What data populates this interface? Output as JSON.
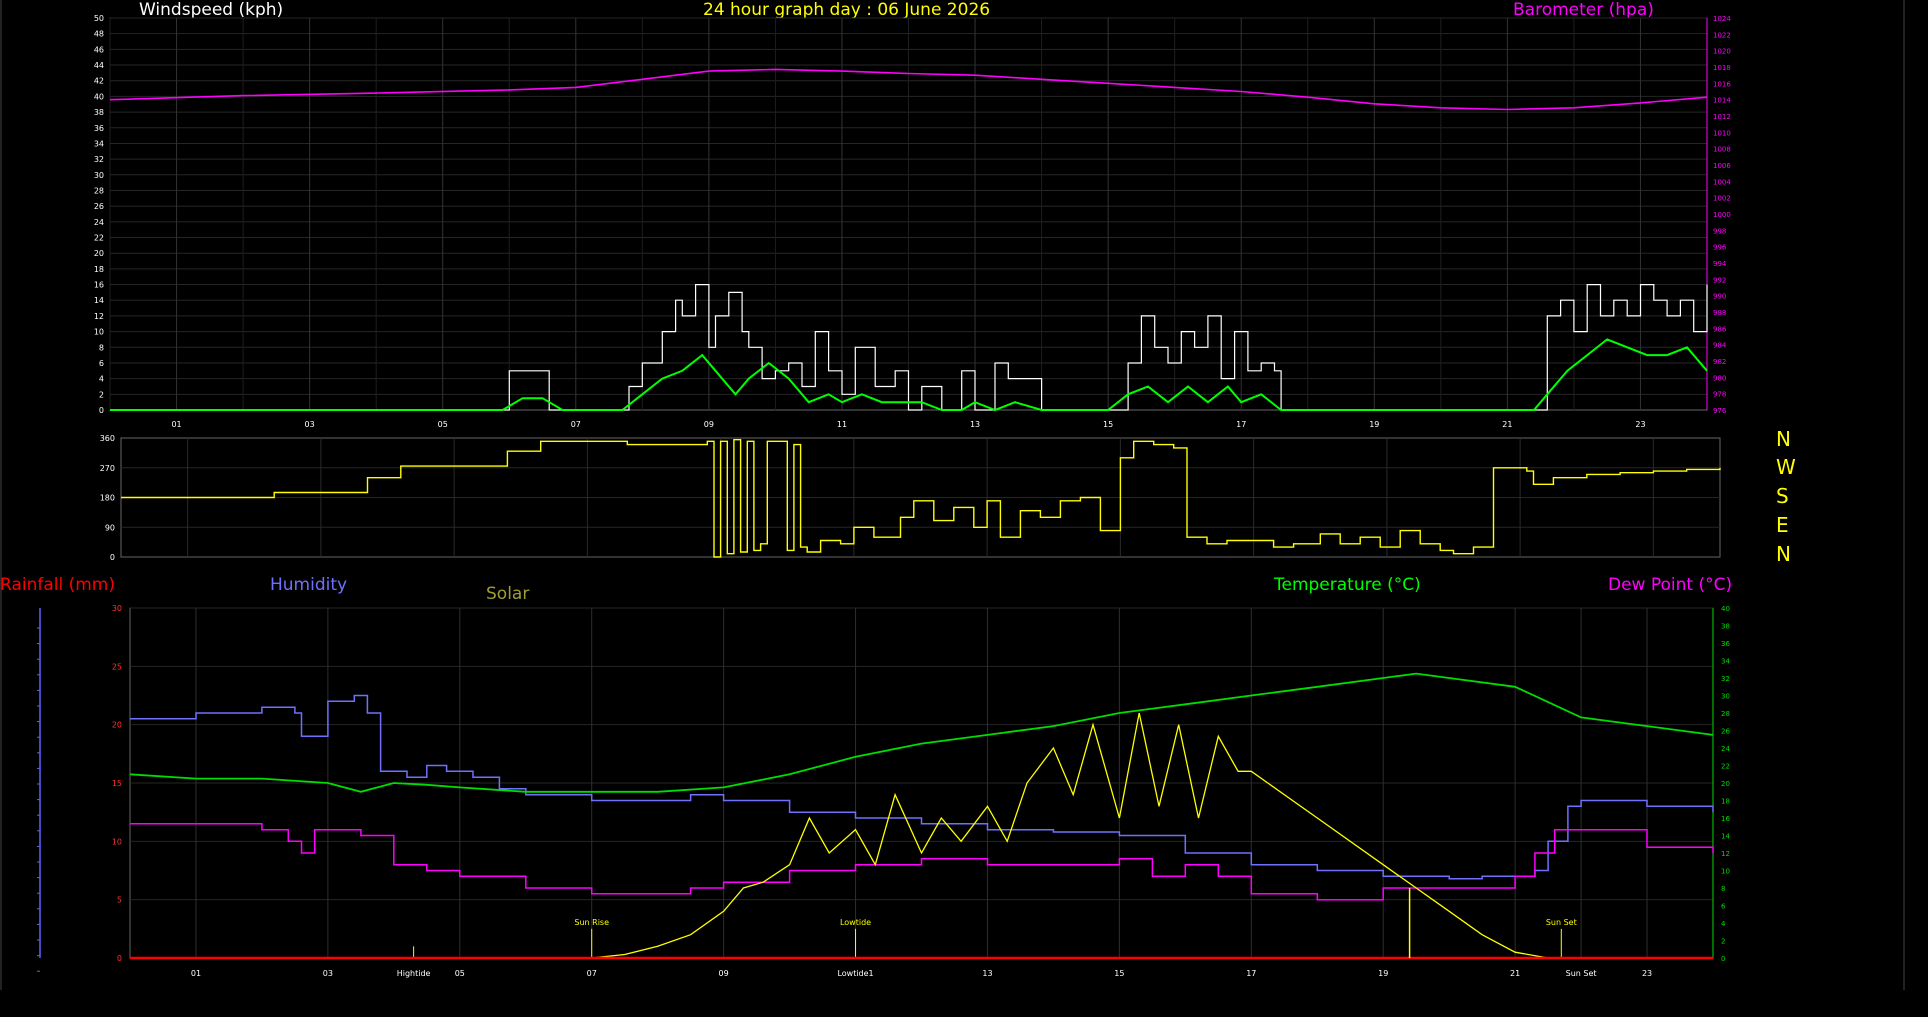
{
  "header": {
    "windspeed_title": "Windspeed (kph)",
    "main_title": "24 hour graph day : 06 June 2026",
    "barometer_title": "Barometer (hpa)"
  },
  "compass": [
    "N",
    "W",
    "S",
    "E",
    "N"
  ],
  "bottom_labels": {
    "rainfall": "Rainfall (mm)",
    "humidity": "Humidity",
    "solar": "Solar",
    "temperature": "Temperature (°C)",
    "dewpoint": "Dew Point (°C)"
  },
  "colors": {
    "background": "#000000",
    "windspeed": "#ffffff",
    "wind_avg": "#00ff00",
    "barometer": "#ff00ff",
    "direction": "#ffff00",
    "humidity": "#7070ff",
    "solar": "#ffff00",
    "temperature": "#00dd00",
    "dewpoint": "#ff00ff",
    "rainfall": "#ff0000"
  },
  "chart_data": [
    {
      "type": "line",
      "name": "wind-barometer",
      "title": "Windspeed (kph)",
      "y2label": "Barometer (hpa)",
      "xlim": [
        0,
        24
      ],
      "ylim": [
        0,
        50
      ],
      "y2lim": [
        976,
        1024
      ],
      "x_ticks": [
        "01",
        "03",
        "05",
        "07",
        "09",
        "11",
        "13",
        "15",
        "17",
        "19",
        "21",
        "23"
      ],
      "y_ticks": [
        0,
        2,
        4,
        6,
        8,
        10,
        12,
        14,
        16,
        18,
        20,
        22,
        24,
        26,
        28,
        30,
        32,
        34,
        36,
        38,
        40,
        42,
        44,
        46,
        48,
        50
      ],
      "y2_ticks": [
        976,
        978,
        980,
        982,
        984,
        986,
        988,
        990,
        992,
        994,
        996,
        998,
        1000,
        1002,
        1004,
        1006,
        1008,
        1010,
        1012,
        1014,
        1016,
        1018,
        1020,
        1022,
        1024
      ],
      "series": [
        {
          "key": "gust",
          "x": [
            0,
            5.9,
            6.0,
            6.5,
            6.6,
            7.7,
            7.8,
            8.0,
            8.3,
            8.5,
            8.6,
            8.8,
            9.0,
            9.1,
            9.3,
            9.5,
            9.6,
            9.8,
            10.0,
            10.2,
            10.4,
            10.6,
            10.8,
            11.0,
            11.2,
            11.5,
            11.8,
            12.0,
            12.2,
            12.5,
            12.8,
            13.0,
            13.3,
            13.5,
            14.0,
            15.1,
            15.3,
            15.5,
            15.7,
            15.9,
            16.1,
            16.3,
            16.5,
            16.7,
            16.9,
            17.1,
            17.3,
            17.5,
            17.6,
            21.5,
            21.6,
            21.8,
            22.0,
            22.2,
            22.4,
            22.6,
            22.8,
            23.0,
            23.2,
            23.4,
            23.6,
            23.8,
            24.0
          ],
          "y": [
            0,
            0,
            5,
            5,
            0,
            0,
            3,
            6,
            10,
            14,
            12,
            16,
            8,
            12,
            15,
            10,
            8,
            4,
            5,
            6,
            3,
            10,
            5,
            2,
            8,
            3,
            5,
            0,
            3,
            0,
            5,
            0,
            6,
            4,
            0,
            0,
            6,
            12,
            8,
            6,
            10,
            8,
            12,
            4,
            10,
            5,
            6,
            5,
            0,
            0,
            12,
            14,
            10,
            16,
            12,
            14,
            12,
            16,
            14,
            12,
            14,
            10,
            16
          ]
        },
        {
          "key": "avg",
          "x": [
            0,
            5.9,
            6.2,
            6.5,
            6.8,
            7.7,
            8.0,
            8.3,
            8.6,
            8.9,
            9.1,
            9.4,
            9.6,
            9.9,
            10.2,
            10.5,
            10.8,
            11.0,
            11.3,
            11.6,
            11.9,
            12.2,
            12.5,
            12.8,
            13.0,
            13.3,
            13.6,
            14.0,
            15.0,
            15.3,
            15.6,
            15.9,
            16.2,
            16.5,
            16.8,
            17.0,
            17.3,
            17.6,
            21.4,
            21.6,
            21.9,
            22.2,
            22.5,
            22.8,
            23.1,
            23.4,
            23.7,
            24.0
          ],
          "y": [
            0,
            0,
            1.5,
            1.5,
            0,
            0,
            2,
            4,
            5,
            7,
            5,
            2,
            4,
            6,
            4,
            1,
            2,
            1,
            2,
            1,
            1,
            1,
            0,
            0,
            1,
            0,
            1,
            0,
            0,
            2,
            3,
            1,
            3,
            1,
            3,
            1,
            2,
            0,
            0,
            2,
            5,
            7,
            9,
            8,
            7,
            7,
            8,
            5
          ]
        },
        {
          "key": "baro",
          "x": [
            0,
            2,
            4,
            6,
            7,
            8,
            9,
            10,
            11,
            12,
            13,
            14,
            15,
            16,
            17,
            18,
            19,
            20,
            21,
            22,
            23,
            24
          ],
          "y": [
            1014,
            1014.5,
            1014.8,
            1015.2,
            1015.5,
            1016.5,
            1017.5,
            1017.7,
            1017.5,
            1017.2,
            1017.0,
            1016.5,
            1016.0,
            1015.5,
            1015.0,
            1014.3,
            1013.5,
            1013.0,
            1012.8,
            1013.0,
            1013.6,
            1014.3
          ]
        }
      ]
    },
    {
      "type": "line",
      "name": "wind-direction",
      "xlim": [
        0,
        24
      ],
      "ylim": [
        0,
        360
      ],
      "y_ticks": [
        0,
        90,
        180,
        270,
        360
      ],
      "series": [
        {
          "key": "dir",
          "x": [
            0,
            2.2,
            2.3,
            3.6,
            3.7,
            4.1,
            4.2,
            5.7,
            5.8,
            6.2,
            6.3,
            7.5,
            7.6,
            8.8,
            8.9,
            9.0,
            9.1,
            9.2,
            9.3,
            9.4,
            9.5,
            9.6,
            9.7,
            10.0,
            10.1,
            10.2,
            10.3,
            10.5,
            10.8,
            11.0,
            11.3,
            11.7,
            11.9,
            12.2,
            12.5,
            12.8,
            13.0,
            13.2,
            13.5,
            13.8,
            14.1,
            14.4,
            14.7,
            15.0,
            15.2,
            15.5,
            15.8,
            16.0,
            16.3,
            16.6,
            17.0,
            17.3,
            17.6,
            18.0,
            18.3,
            18.6,
            18.9,
            19.2,
            19.5,
            19.8,
            20.0,
            20.3,
            20.6,
            21.0,
            21.1,
            21.2,
            21.5,
            22.0,
            22.5,
            23.0,
            23.5,
            24.0
          ],
          "y": [
            180,
            180,
            195,
            195,
            240,
            240,
            275,
            275,
            320,
            320,
            350,
            350,
            340,
            350,
            0,
            350,
            10,
            355,
            15,
            350,
            20,
            40,
            350,
            20,
            340,
            30,
            15,
            50,
            40,
            90,
            60,
            120,
            170,
            110,
            150,
            90,
            170,
            60,
            140,
            120,
            170,
            180,
            80,
            300,
            350,
            340,
            330,
            60,
            40,
            50,
            50,
            30,
            40,
            70,
            40,
            60,
            30,
            80,
            40,
            20,
            10,
            30,
            270,
            270,
            260,
            220,
            240,
            250,
            255,
            260,
            265,
            270
          ]
        }
      ]
    },
    {
      "type": "line",
      "name": "temp-humidity-solar-rain",
      "xlim": [
        0,
        24
      ],
      "ylim": [
        0,
        30
      ],
      "y2lim": [
        0,
        40
      ],
      "x_ticks": [
        "01",
        "03",
        "Hightide",
        "05",
        "07",
        "09",
        "Lowtide1",
        "13",
        "15",
        "17",
        "19",
        "21",
        "Sun Set",
        "23"
      ],
      "y_ticks": [
        0,
        5,
        10,
        15,
        20,
        25,
        30
      ],
      "y2_ticks": [
        0,
        2,
        4,
        6,
        8,
        10,
        12,
        14,
        16,
        18,
        20,
        22,
        24,
        26,
        28,
        30,
        32,
        34,
        36,
        38,
        40
      ],
      "annotations": [
        "Sun Rise",
        "Lowtide",
        "Sun Set",
        "Hightide"
      ],
      "series": [
        {
          "key": "humidity",
          "x": [
            0,
            1,
            2,
            2.5,
            2.6,
            2.8,
            3.0,
            3.4,
            3.6,
            3.8,
            4.2,
            4.5,
            4.8,
            5.2,
            5.6,
            6.0,
            7,
            8,
            8.5,
            9,
            10,
            11,
            12,
            13,
            14,
            15,
            16,
            17,
            18,
            19,
            20,
            20.5,
            21,
            21.3,
            21.5,
            21.8,
            22,
            23,
            24
          ],
          "y": [
            20.5,
            21,
            21.5,
            21,
            19,
            19,
            22,
            22.5,
            21,
            16,
            15.5,
            16.5,
            16,
            15.5,
            14.5,
            14,
            13.5,
            13.5,
            14,
            13.5,
            12.5,
            12,
            11.5,
            11,
            10.8,
            10.5,
            9,
            8,
            7.5,
            7,
            6.8,
            7,
            7,
            7.5,
            10,
            13,
            13.5,
            13,
            12.5
          ]
        },
        {
          "key": "temperature",
          "x": [
            0,
            1,
            2,
            3,
            3.5,
            4,
            4.5,
            5,
            6,
            7,
            8,
            9,
            10,
            11,
            12,
            13,
            14,
            15,
            16,
            17,
            18,
            19,
            19.5,
            20,
            21,
            22,
            23,
            24
          ],
          "y": [
            21,
            20.5,
            20.5,
            20,
            19,
            20,
            19.8,
            19.5,
            19,
            19,
            19,
            19.5,
            21,
            23,
            24.5,
            25.5,
            26.5,
            28,
            29,
            30,
            31,
            32,
            32.5,
            32,
            31,
            27.5,
            26.5,
            25.5
          ]
        },
        {
          "key": "dewpoint",
          "x": [
            0,
            1,
            2,
            2.4,
            2.6,
            2.8,
            3.0,
            3.5,
            4,
            4.5,
            5,
            6,
            7,
            8,
            8.5,
            9,
            10,
            11,
            12,
            13,
            14,
            15,
            15.5,
            16,
            16.5,
            17,
            18,
            19,
            20,
            21,
            21.3,
            21.6,
            22,
            23,
            24
          ],
          "y": [
            11.5,
            11.5,
            11,
            10,
            9,
            11,
            11,
            10.5,
            8,
            7.5,
            7,
            6,
            5.5,
            5.5,
            6,
            6.5,
            7.5,
            8,
            8.5,
            8,
            8,
            8.5,
            7,
            8,
            7,
            5.5,
            5,
            6,
            6,
            7,
            9,
            11,
            11,
            9.5,
            9
          ]
        },
        {
          "key": "solar",
          "x": [
            0,
            7,
            7.5,
            8,
            8.5,
            9,
            9.3,
            9.6,
            10,
            10.3,
            10.6,
            11,
            11.3,
            11.6,
            12,
            12.3,
            12.6,
            13,
            13.3,
            13.6,
            14,
            14.3,
            14.6,
            15,
            15.3,
            15.6,
            15.9,
            16.2,
            16.5,
            16.8,
            17,
            18,
            19,
            19.5,
            20,
            20.5,
            21,
            21.5,
            24
          ],
          "y": [
            0,
            0,
            0.3,
            1,
            2,
            4,
            6,
            6.5,
            8,
            12,
            9,
            11,
            8,
            14,
            9,
            12,
            10,
            13,
            10,
            15,
            18,
            14,
            20,
            12,
            21,
            13,
            20,
            12,
            19,
            16,
            16,
            12,
            8,
            6,
            4,
            2,
            0.5,
            0,
            0
          ]
        },
        {
          "key": "rainfall",
          "x": [
            0,
            24
          ],
          "y": [
            0,
            0
          ]
        }
      ]
    }
  ]
}
